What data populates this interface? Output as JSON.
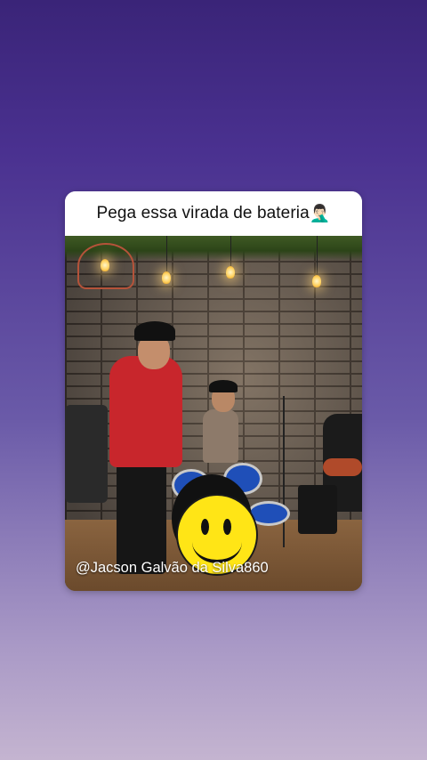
{
  "caption": {
    "text": "Pega essa virada de bateria",
    "emoji": "🤦🏻‍♂️"
  },
  "video": {
    "watermark": "@Jacson Galvão da Silva860",
    "sticker_icon": "smiley-face-icon"
  },
  "colors": {
    "background_top": "#3a2478",
    "background_bottom": "#c4b4d0",
    "caption_bg": "#ffffff",
    "sticker": "#ffe516"
  }
}
